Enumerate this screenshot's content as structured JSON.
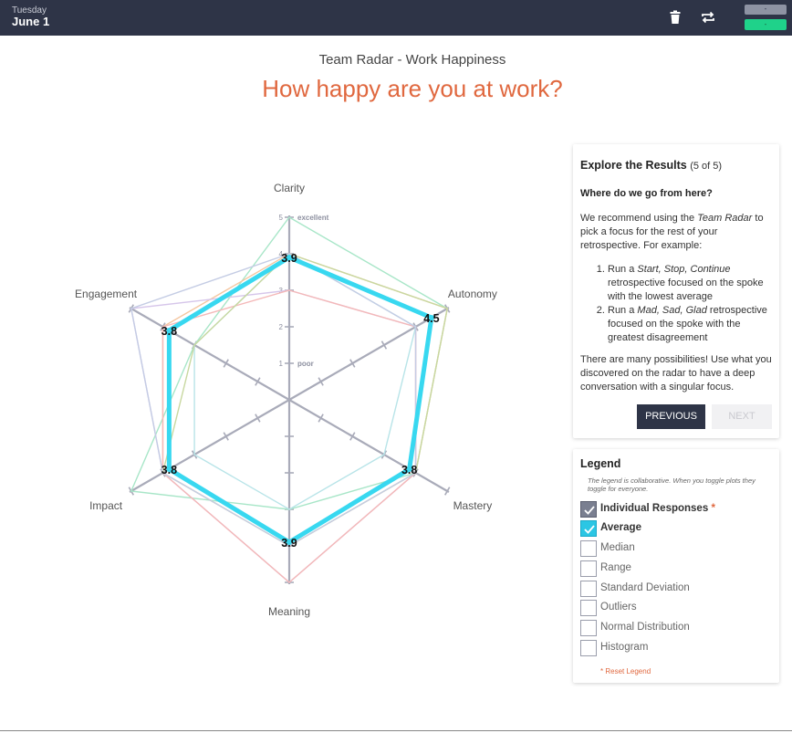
{
  "header": {
    "day": "Tuesday",
    "date": "June 1",
    "pill_top": "-",
    "pill_bottom": "-",
    "icons": [
      "trash-icon",
      "repeat-icon"
    ]
  },
  "page": {
    "subtitle": "Team Radar - Work Happiness",
    "question": "How happy are you at work?",
    "accent_color": "#e0683f",
    "header_color": "#2e3447"
  },
  "chart_data": {
    "type": "radar",
    "axes": [
      "Clarity",
      "Autonomy",
      "Mastery",
      "Meaning",
      "Impact",
      "Engagement"
    ],
    "scale_max": 5,
    "scale_ticks": [
      1,
      2,
      3,
      4,
      5
    ],
    "scale_tick_labels": {
      "1": "poor",
      "5": "excellent"
    },
    "series": [
      {
        "name": "Average",
        "color": "#38d8f0",
        "values": [
          3.9,
          4.5,
          3.8,
          3.9,
          3.8,
          3.8
        ],
        "labels": [
          "3.9",
          "4.5",
          "3.8",
          "3.9",
          "3.8",
          "3.8"
        ]
      },
      {
        "color": "#a8e6c8",
        "values": [
          5,
          5,
          4,
          3,
          5,
          3
        ]
      },
      {
        "color": "#f4c6a0",
        "values": [
          4,
          5,
          4,
          4,
          4,
          4
        ]
      },
      {
        "color": "#d6c6ea",
        "values": [
          3,
          4,
          4,
          5,
          4,
          5
        ]
      },
      {
        "color": "#f4b8b8",
        "values": [
          3,
          4,
          4,
          5,
          4,
          4
        ]
      },
      {
        "color": "#b8e4e8",
        "values": [
          4,
          4,
          3,
          3,
          3,
          3
        ]
      },
      {
        "color": "#c8d8a0",
        "values": [
          4,
          5,
          4,
          4,
          4,
          3
        ]
      },
      {
        "color": "#c4cce4",
        "values": [
          4,
          4,
          4,
          4,
          4,
          5
        ]
      }
    ]
  },
  "explore": {
    "title": "Explore the Results",
    "step": "(5 of 5)",
    "subtitle": "Where do we go from here?",
    "intro_a": "We recommend using the ",
    "intro_em": "Team Radar",
    "intro_b": " to pick a focus for the rest of your retrospective. For example:",
    "items": [
      {
        "a": "Run a ",
        "em": "Start, Stop, Continue",
        "b": " retrospective focused on the spoke with the lowest average"
      },
      {
        "a": "Run a ",
        "em": "Mad, Sad, Glad",
        "b": " retrospective focused on the spoke with the greatest disagreement"
      }
    ],
    "outro": "There are many possibilities! Use what you discovered on the radar to have a deep conversation with a singular focus.",
    "prev_label": "PREVIOUS",
    "next_label": "NEXT"
  },
  "legend": {
    "title": "Legend",
    "note": "The legend is collaborative. When you toggle plots they toggle for everyone.",
    "items": [
      {
        "label": "Individual Responses",
        "star": "*"
      },
      {
        "label": "Average"
      },
      {
        "label": "Median"
      },
      {
        "label": "Range"
      },
      {
        "label": "Standard Deviation"
      },
      {
        "label": "Outliers"
      },
      {
        "label": "Normal Distribution"
      },
      {
        "label": "Histogram"
      }
    ],
    "reset_label": "* Reset Legend"
  }
}
